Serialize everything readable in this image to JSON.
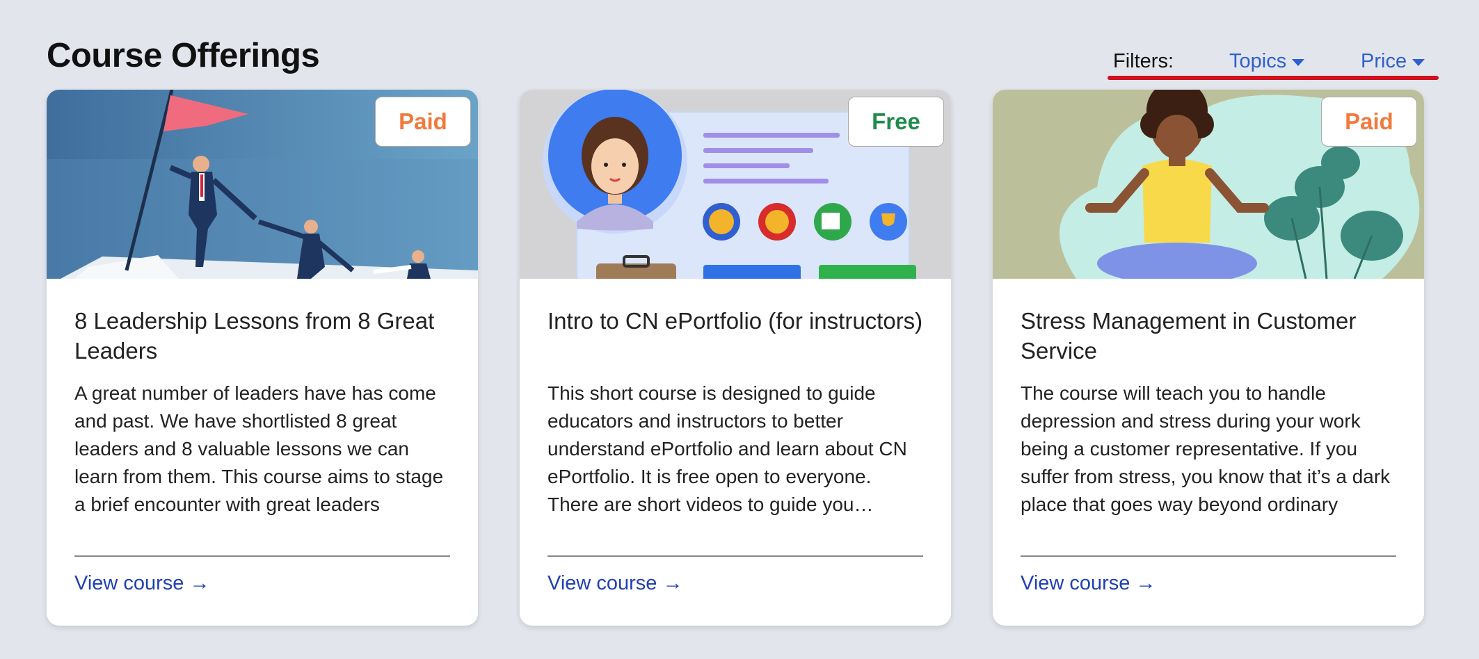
{
  "page": {
    "title": "Course Offerings"
  },
  "filters": {
    "label": "Filters:",
    "topics": "Topics",
    "price": "Price"
  },
  "colors": {
    "accent": "#2f5fd0",
    "paid": "#f07a3c",
    "free": "#1f8a4c",
    "underline": "#d0101c"
  },
  "cards": [
    {
      "badge": "Paid",
      "title": "8 Leadership Lessons from 8 Great Leaders",
      "description": "A great number of leaders have has come and past. We have shortlisted 8 great leaders and 8 valuable lessons we can learn from them. This course aims to stage a brief encounter with great leaders",
      "link": "View course →"
    },
    {
      "badge": "Free",
      "title": "Intro to CN ePortfolio (for instructors)",
      "description": "This short course is designed to guide educators and instructors to better understand ePortfolio and learn about CN ePortfolio. It is free open to everyone. There are short videos to guide you through",
      "link": "View course →"
    },
    {
      "badge": "Paid",
      "title": "Stress Management in Customer Service",
      "description": "The course will teach you to handle depression and stress during your work being a customer representative. If you suffer from stress, you know that it’s a dark place that goes way beyond ordinary",
      "link": "View course →"
    }
  ]
}
